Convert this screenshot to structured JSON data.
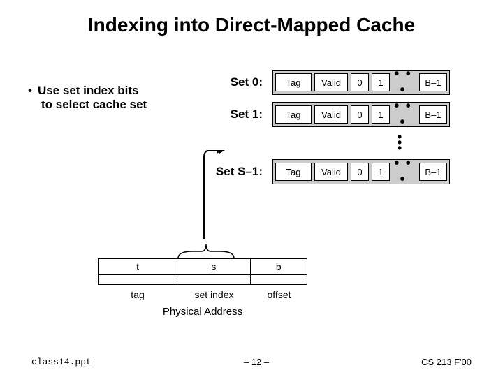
{
  "title": "Indexing into Direct-Mapped Cache",
  "bullet": {
    "line1": "Use set index bits",
    "line2": "to select cache set"
  },
  "sets": {
    "row0_label": "Set 0:",
    "row1_label": "Set 1:",
    "rowLast_label": "Set S–1:",
    "tag": "Tag",
    "valid": "Valid",
    "b0": "0",
    "b1": "1",
    "bLast": "B–1",
    "hdots": "• • •",
    "vdots": "•\n•\n•"
  },
  "addr": {
    "t": "t",
    "s": "s",
    "b": "b",
    "tag": "tag",
    "setindex": "set index",
    "offset": "offset",
    "phys": "Physical Address"
  },
  "footer": {
    "file": "class14.ppt",
    "page": "– 12 –",
    "course": "CS 213 F'00"
  }
}
